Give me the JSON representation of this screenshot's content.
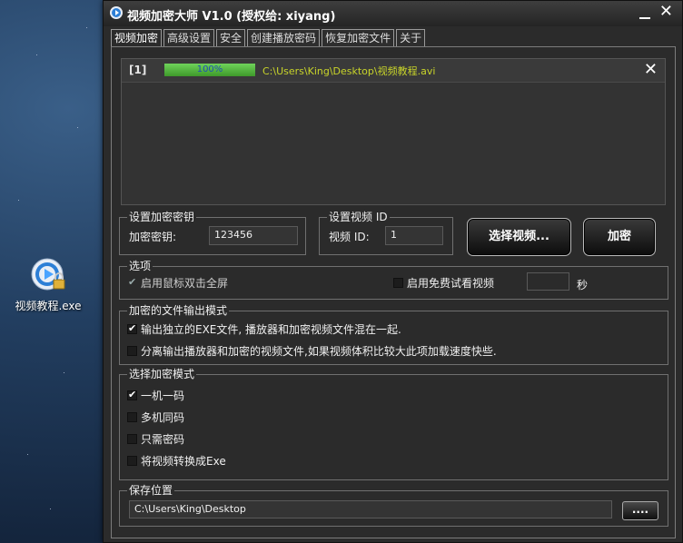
{
  "desktop": {
    "icon_label": "视频教程.exe"
  },
  "window": {
    "title": "视频加密大师 V1.0 (授权给: xiyang)",
    "close_glyph": "✕"
  },
  "tabs": [
    {
      "label": "视频加密",
      "active": true
    },
    {
      "label": "高级设置"
    },
    {
      "label": "安全"
    },
    {
      "label": "创建播放密码"
    },
    {
      "label": "恢复加密文件"
    },
    {
      "label": "关于"
    }
  ],
  "file_list": {
    "items": [
      {
        "index": "[1]",
        "progress_text": "100%",
        "progress": 1.0,
        "path": "C:\\Users\\King\\Desktop\\视频教程.avi",
        "remove_glyph": "✕"
      }
    ]
  },
  "key_group": {
    "title": "设置加密密钥",
    "label": "加密密钥:",
    "value": "123456"
  },
  "id_group": {
    "title": "设置视频 ID",
    "label": "视频 ID:",
    "value": "1"
  },
  "buttons": {
    "select_video": "选择视频...",
    "encrypt": "加密",
    "browse": "...."
  },
  "options": {
    "title": "选项",
    "dblclick_fullscreen": {
      "label": "启用鼠标双击全屏",
      "checked": true,
      "disabled": true
    },
    "free_preview": {
      "label": "启用免费试看视频",
      "checked": false
    },
    "preview_seconds": "",
    "seconds_unit": "秒"
  },
  "output_mode": {
    "title": "加密的文件输出模式",
    "items": [
      {
        "label": "输出独立的EXE文件, 播放器和加密视频文件混在一起.",
        "checked": true
      },
      {
        "label": "分离输出播放器和加密的视频文件,如果视频体积比较大此项加载速度快些.",
        "checked": false
      }
    ]
  },
  "encrypt_mode": {
    "title": "选择加密模式",
    "items": [
      {
        "label": "一机一码",
        "checked": true
      },
      {
        "label": "多机同码",
        "checked": false
      },
      {
        "label": "只需密码",
        "checked": false
      },
      {
        "label": "将视频转换成Exe",
        "checked": false
      }
    ]
  },
  "save": {
    "title": "保存位置",
    "path": "C:\\Users\\King\\Desktop"
  },
  "colors": {
    "path_text": "#c8d42a",
    "progress_fill": "#4fbf3a",
    "progress_text": "#1e4fb4"
  }
}
